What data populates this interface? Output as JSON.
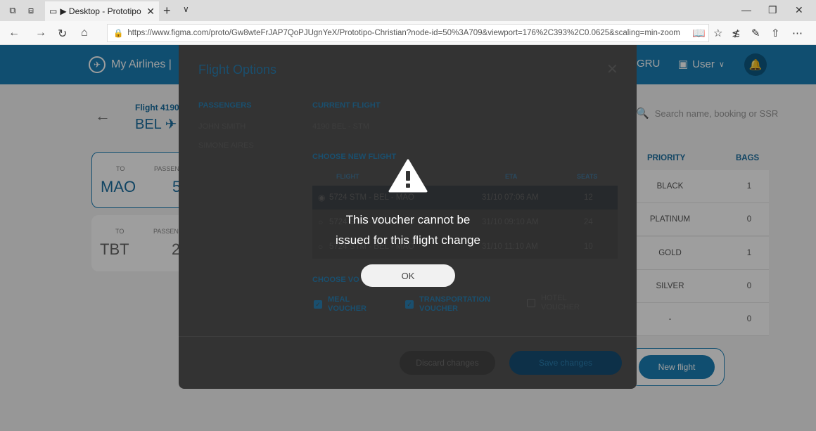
{
  "browser": {
    "tab_title": "▶ Desktop - Prototipo (",
    "url": "https://www.figma.com/proto/Gw8wteFrJAP7QoPJUgnYeX/Prototipo-Christian?node-id=50%3A709&viewport=176%2C393%2C0.0625&scaling=min-zoom"
  },
  "app": {
    "brand": "My Airlines |",
    "airport": "GRU",
    "user": "User",
    "back_flight_number": "Flight 4190",
    "back_route": "BEL ✈",
    "search_placeholder": "Search name, booking or SSR",
    "cards": [
      {
        "to_label": "TO",
        "pass_label": "PASSEN",
        "to": "MAO",
        "pass": "5"
      },
      {
        "to_label": "TO",
        "pass_label": "PASSEN",
        "to": "TBT",
        "pass": "2"
      }
    ],
    "table": {
      "priority_header": "PRIORITY",
      "bags_header": "BAGS",
      "rows": [
        {
          "priority": "BLACK",
          "bags": "1"
        },
        {
          "priority": "PLATINUM",
          "bags": "0"
        },
        {
          "priority": "GOLD",
          "bags": "1"
        },
        {
          "priority": "SILVER",
          "bags": "0"
        },
        {
          "priority": "-",
          "bags": "0"
        }
      ]
    },
    "new_flight_button": "New flight"
  },
  "modal": {
    "title": "Flight Options",
    "passengers_heading": "PASSENGERS",
    "passengers": [
      "JOHN SMITH",
      "SIMONE AIRES"
    ],
    "current_heading": "CURRENT FLIGHT",
    "current_flight": "4190 BEL - STM",
    "choose_new_heading": "CHOOSE NEW FLIGHT",
    "col_flight": "FLIGHT",
    "col_eta": "ETA",
    "col_seats": "SEATS",
    "flights": [
      {
        "route": "5724 STM - BEL - MAO",
        "eta": "31/10 07:06 AM",
        "seats": "12"
      },
      {
        "route": "5724 STM - BEL - MAO",
        "eta": "31/10 09:10 AM",
        "seats": "24"
      },
      {
        "route": "5724 STM - BEL - MAO",
        "eta": "31/10 11:10 AM",
        "seats": "10"
      }
    ],
    "choose_voucher_heading": "CHOOSE VO",
    "vouchers": [
      {
        "line1": "MEAL",
        "line2": "VOUCHER"
      },
      {
        "line1": "TRANSPORTATION",
        "line2": "VOUCHER"
      },
      {
        "line1": "HOTEL",
        "line2": "VOUCHER"
      }
    ],
    "discard_button": "Discard changes",
    "save_button": "Save changes"
  },
  "alert": {
    "line1": "This voucher cannot be",
    "line2": "issued for this flight change",
    "ok_button": "OK"
  }
}
